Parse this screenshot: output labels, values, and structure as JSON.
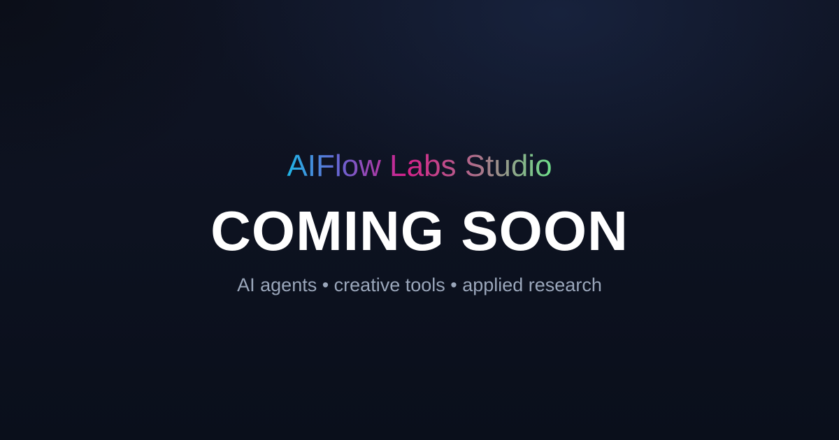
{
  "brand": {
    "name": "AIFlow Labs Studio"
  },
  "hero": {
    "headline": "COMING SOON",
    "tagline": "AI agents • creative tools • applied research"
  },
  "colors": {
    "background": "#0e1322",
    "headline": "#ffffff",
    "tagline": "#9aa6ba",
    "gradient_start": "#1fb6e6",
    "gradient_mid": "#d6208a",
    "gradient_end": "#6ee08a"
  }
}
